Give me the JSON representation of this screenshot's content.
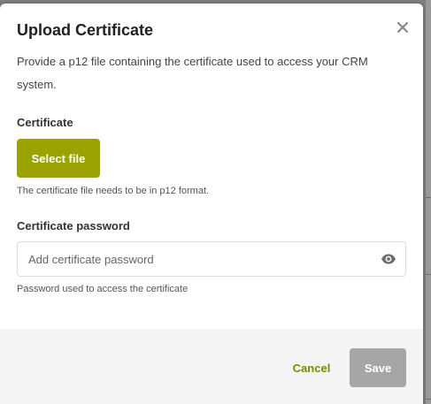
{
  "modal": {
    "title": "Upload Certificate",
    "description": "Provide a p12 file containing the certificate used to access your CRM system."
  },
  "certificate": {
    "label": "Certificate",
    "select_file_label": "Select file",
    "hint": "The certificate file needs to be in p12 format."
  },
  "password": {
    "label": "Certificate password",
    "placeholder": "Add certificate password",
    "value": "",
    "hint": "Password used to access the certificate",
    "toggle_icon": "eye-icon"
  },
  "footer": {
    "cancel_label": "Cancel",
    "save_label": "Save",
    "save_enabled": false
  },
  "colors": {
    "primary": "#9aa302",
    "link": "#7d8a00",
    "disabled": "#a6a6a6"
  }
}
